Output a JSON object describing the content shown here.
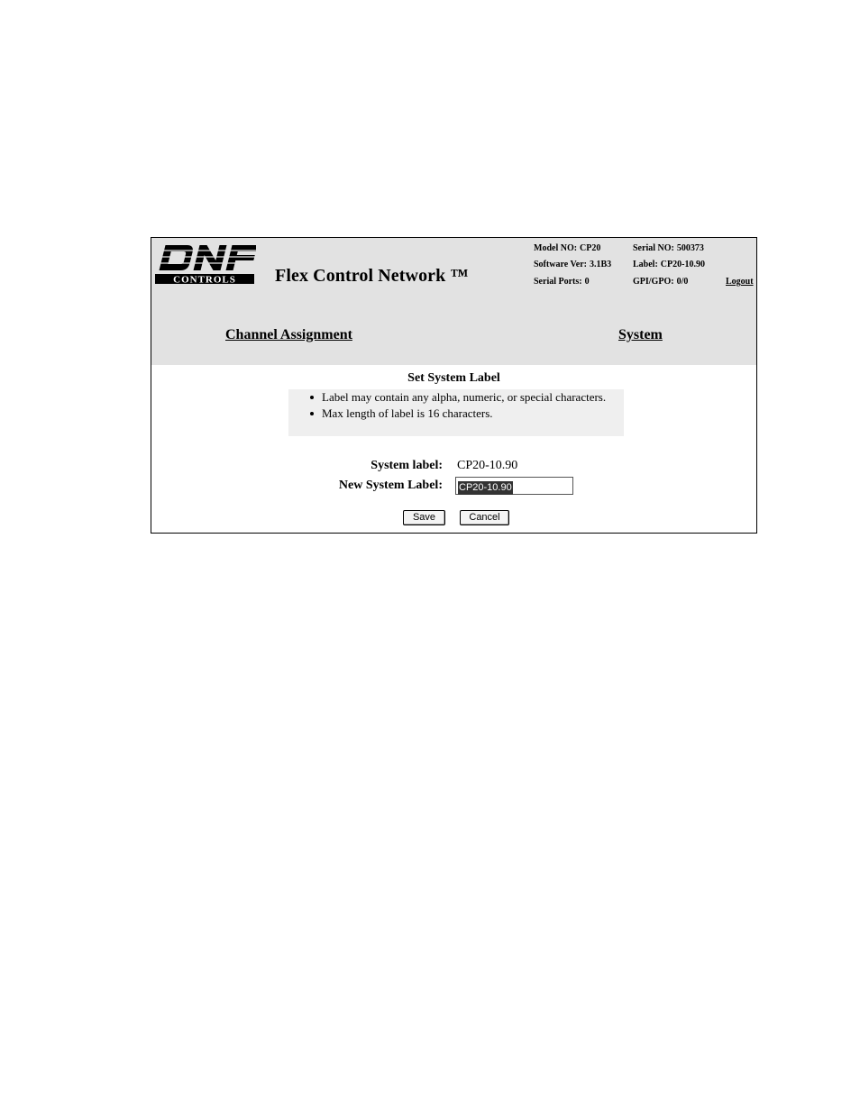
{
  "logo": {
    "brand": "DNF",
    "sub": "CONTROLS"
  },
  "header": {
    "title": "Flex Control Network ™",
    "model_key": "Model NO:",
    "model_val": "CP20",
    "serial_key": "Serial NO:",
    "serial_val": "500373",
    "software_key": "Software Ver:",
    "software_val": "3.1B3",
    "label_key": "Label:",
    "label_val": "CP20-10.90",
    "ports_key": "Serial Ports:",
    "ports_val": "0",
    "gpi_key": "GPI/GPO:",
    "gpi_val": "0/0",
    "logout": "Logout"
  },
  "nav": {
    "channel_assignment": "Channel Assignment",
    "system": "System"
  },
  "main": {
    "section_title": "Set System Label",
    "notes": [
      "Label may contain any alpha, numeric, or special characters.",
      "Max length of label is 16 characters."
    ],
    "system_label_label": "System label:",
    "system_label_value": "CP20-10.90",
    "new_label_label": "New System Label:",
    "new_label_value": "CP20-10.90",
    "save": "Save",
    "cancel": "Cancel"
  },
  "colors": {
    "header_bg": "#e2e2e2",
    "notes_bg": "#efefef"
  }
}
